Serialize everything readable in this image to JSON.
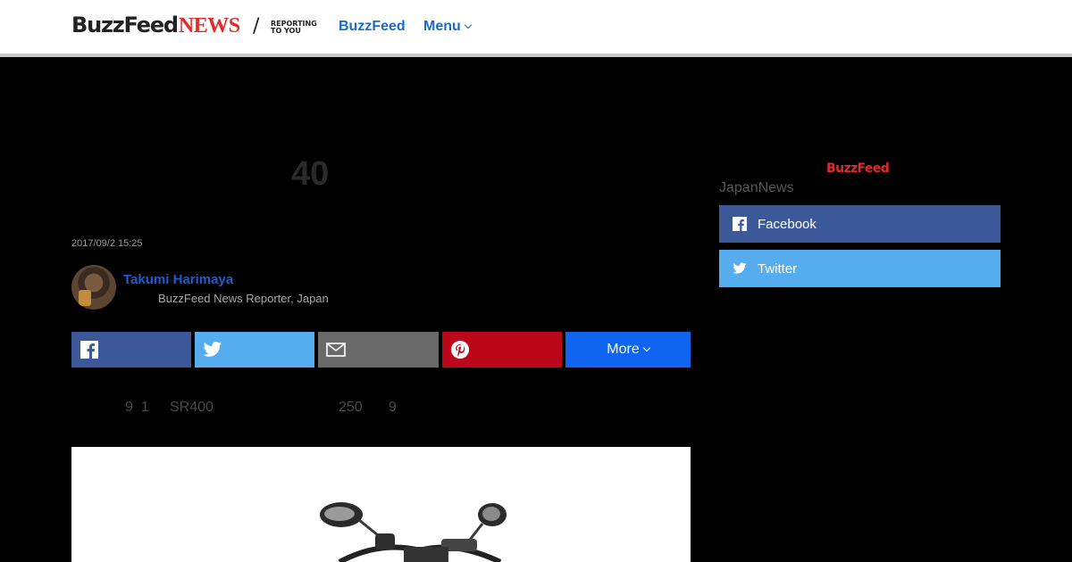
{
  "header": {
    "logo_main": "BuzzFeed",
    "logo_news": "NEWS",
    "tagline_line1": "REPORTING",
    "tagline_line2": "TO YOU",
    "nav_buzzfeed": "BuzzFeed",
    "nav_menu": "Menu"
  },
  "article": {
    "headline": "40",
    "timestamp": "2017/09/2 15:25",
    "author": {
      "name": "Takumi Harimaya",
      "role": "BuzzFeed News Reporter, Japan"
    },
    "share": {
      "more_label": "More"
    },
    "summary": [
      "9",
      "1",
      "SR400",
      "250",
      "9"
    ]
  },
  "sidebar": {
    "logo": "BuzzFeed",
    "title": "JapanNews",
    "buttons": [
      {
        "label": "Facebook",
        "icon": "facebook-icon"
      },
      {
        "label": "Twitter",
        "icon": "twitter-icon"
      }
    ]
  },
  "colors": {
    "brand_red": "#e32a2a",
    "link_blue": "#1b6ac9",
    "facebook": "#3b5998",
    "twitter": "#55acee",
    "email": "#696969",
    "pinterest": "#bd081c",
    "more": "#0f65ef"
  }
}
